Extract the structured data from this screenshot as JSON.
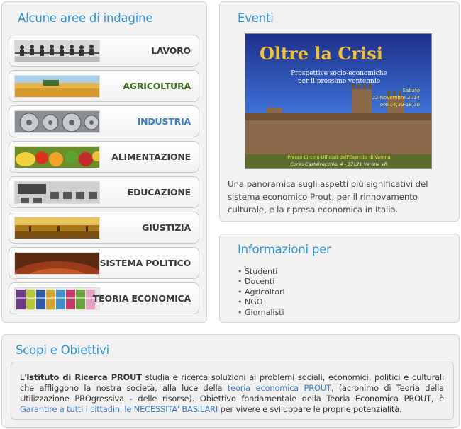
{
  "areas_panel": {
    "title": "Alcune aree di indagine",
    "items": [
      {
        "label": "LAVORO",
        "image": "workers-photo"
      },
      {
        "label": "AGRICOLTURA",
        "image": "wheat-field-photo"
      },
      {
        "label": "INDUSTRIA",
        "image": "gears-photo"
      },
      {
        "label": "ALIMENTAZIONE",
        "image": "fruits-photo"
      },
      {
        "label": "EDUCAZIONE",
        "image": "classroom-photo"
      },
      {
        "label": "GIUSTIZIA",
        "image": "courtroom-photo"
      },
      {
        "label": "SISTEMA POLITICO",
        "image": "parliament-photo"
      },
      {
        "label": "TEORIA ECONOMICA",
        "image": "books-photo"
      }
    ]
  },
  "events_panel": {
    "title": "Eventi",
    "poster": {
      "headline": "Oltre la Crisi",
      "subtitle_line1": "Prospettive socio-economiche",
      "subtitle_line2": "per il prossimo ventennio",
      "day": "Sabato",
      "date": "22 Novembre 2014",
      "time": "ore 14,30-18,30",
      "venue": "Presso Circolo Ufficiali dell'Esercito di Verona",
      "address": "Corso Castelvecchio, 4 - 37121 Verona VR"
    },
    "description": "Una panoramica sugli aspetti più significativi del sistema economico Prout, per il rinnovamento culturale, e la ripresa economica in Italia."
  },
  "info_panel": {
    "title": "Informazioni per",
    "items": [
      "Studenti",
      "Docenti",
      "Agricoltori",
      "NGO",
      "Giornalisti"
    ]
  },
  "scopi_panel": {
    "title": "Scopi e Obiettivi",
    "text_1": "L'",
    "text_bold": "Istituto di Ricerca PROUT",
    "text_2": " studia e ricerca soluzioni ai problemi sociali, economici, politici e culturali che affliggono la nostra società, alla luce della ",
    "link_1": "teoria economica PROUT",
    "text_3": ", (acronimo di Teoria della Utilizzazione PROgressiva - delle risorse). Obiettivo fondamentale della Teoria Economica PROUT, è ",
    "link_2": "Garantire a tutti i cittadini le NECESSITA' BASILARI",
    "text_4": " per vivere e sviluppare le proprie potenzialità."
  },
  "colors": {
    "title_blue": "#2f95d6",
    "link_blue": "#3a7ecb",
    "agricoltura_green": "#3d6b20"
  }
}
